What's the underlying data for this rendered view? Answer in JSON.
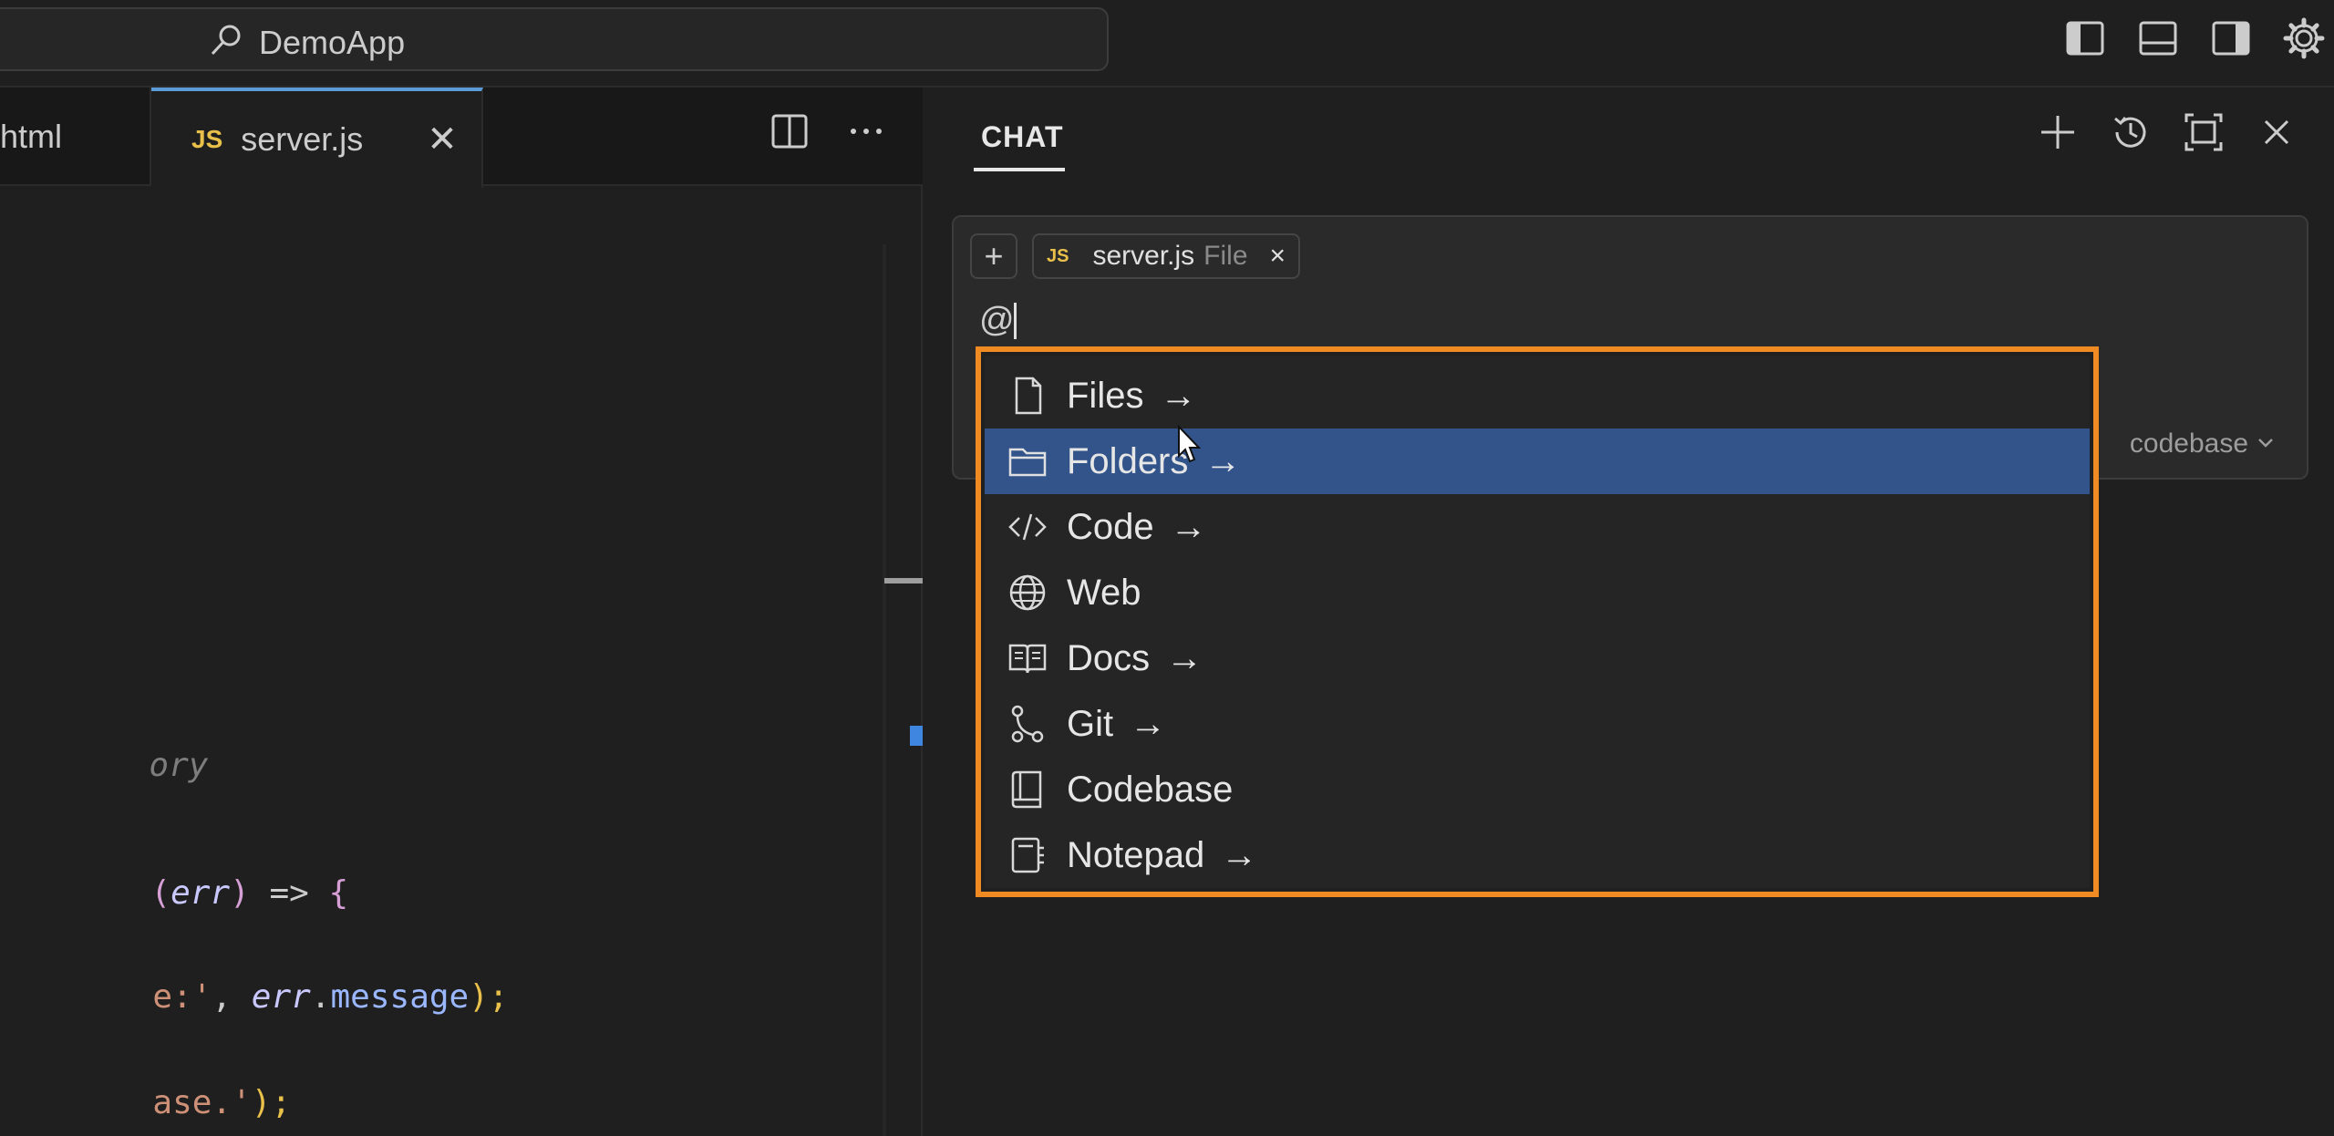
{
  "titlebar": {
    "title": "DemoApp",
    "icons": [
      "toggle-primary-sidebar-icon",
      "toggle-panel-icon",
      "toggle-secondary-sidebar-icon",
      "settings-gear-icon"
    ]
  },
  "editor": {
    "tabs": [
      {
        "label": "html",
        "active": false
      },
      {
        "label": "server.js",
        "badge": "JS",
        "active": true
      }
    ],
    "code_lines": [
      {
        "kind": "comment",
        "text": "ory"
      },
      {
        "kind": "line1"
      },
      {
        "kind": "line2"
      },
      {
        "kind": "line3"
      }
    ],
    "line1": {
      "p1": "(",
      "var": "err",
      "p2": ")",
      "op": " => ",
      "brace": "{"
    },
    "line2": {
      "str": "e:'",
      "comma": ", ",
      "var": "err",
      "dot": ".",
      "prop": "message",
      "end": ");"
    },
    "line3": {
      "str": "ase.'",
      "end": ");"
    }
  },
  "chat": {
    "title": "CHAT",
    "actions": [
      "new-chat-icon",
      "history-icon",
      "maximize-icon",
      "close-icon"
    ],
    "input": {
      "add_label": "+",
      "chip": {
        "badge": "JS",
        "name": "server.js",
        "kind": "File",
        "close": "×"
      },
      "typed": "@",
      "codebase_label": "codebase"
    },
    "menu": [
      {
        "label": "Files",
        "icon": "file-icon",
        "arrow": "→",
        "selected": false
      },
      {
        "label": "Folders",
        "icon": "folder-icon",
        "arrow": "→",
        "selected": true
      },
      {
        "label": "Code",
        "icon": "code-icon",
        "arrow": "→",
        "selected": false
      },
      {
        "label": "Web",
        "icon": "globe-icon",
        "arrow": "",
        "selected": false
      },
      {
        "label": "Docs",
        "icon": "book-icon",
        "arrow": "→",
        "selected": false
      },
      {
        "label": "Git",
        "icon": "git-branch-icon",
        "arrow": "→",
        "selected": false
      },
      {
        "label": "Codebase",
        "icon": "repo-icon",
        "arrow": "",
        "selected": false
      },
      {
        "label": "Notepad",
        "icon": "notepad-icon",
        "arrow": "→",
        "selected": false
      }
    ]
  },
  "colors": {
    "highlight_border": "#f08a22",
    "selection": "#33548a",
    "js_badge": "#e8c04a"
  }
}
